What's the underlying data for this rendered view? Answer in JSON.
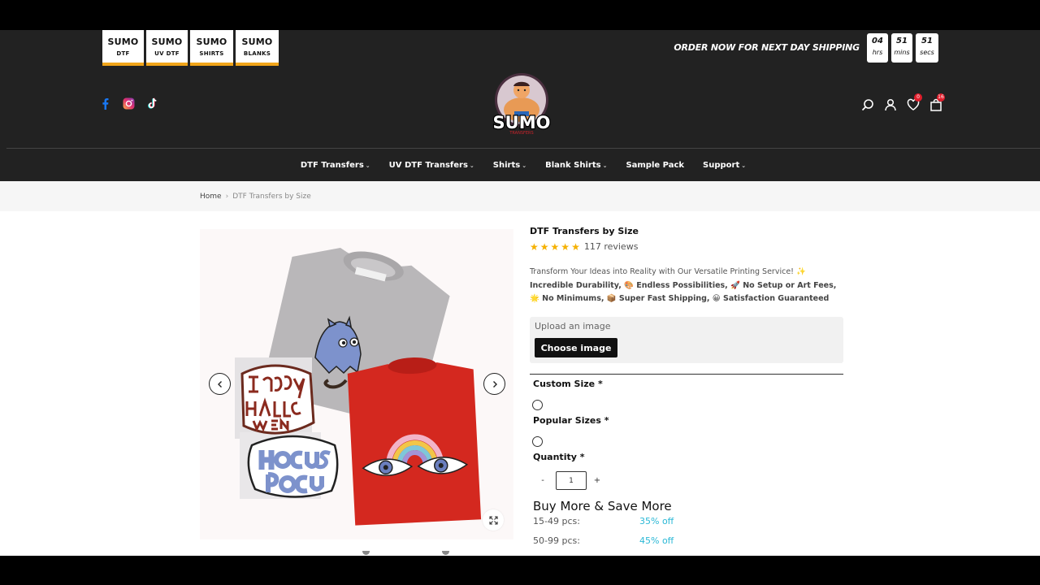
{
  "brand_tabs": [
    {
      "title": "SUMO",
      "sub": "DTF"
    },
    {
      "title": "SUMO",
      "sub": "UV DTF"
    },
    {
      "title": "SUMO",
      "sub": "SHIRTS"
    },
    {
      "title": "SUMO",
      "sub": "BLANKS"
    }
  ],
  "promo": {
    "text": "ORDER NOW FOR NEXT DAY SHIPPING",
    "timer": [
      {
        "value": "04",
        "unit": "hrs"
      },
      {
        "value": "51",
        "unit": "mins"
      },
      {
        "value": "51",
        "unit": "secs"
      }
    ]
  },
  "social": [
    "facebook-icon",
    "instagram-icon",
    "tiktok-icon"
  ],
  "logo": {
    "text": "SUMO",
    "sub": "TRANSFERS"
  },
  "header_icons": {
    "wishlist_count": "0",
    "cart_count": "16"
  },
  "nav": [
    {
      "label": "DTF Transfers",
      "dropdown": true
    },
    {
      "label": "UV DTF Transfers",
      "dropdown": true
    },
    {
      "label": "Shirts",
      "dropdown": true
    },
    {
      "label": "Blank Shirts",
      "dropdown": true
    },
    {
      "label": "Sample Pack",
      "dropdown": false
    },
    {
      "label": "Support",
      "dropdown": true
    }
  ],
  "breadcrumb": {
    "home": "Home",
    "current": "DTF Transfers by Size"
  },
  "product": {
    "title": "DTF Transfers by Size",
    "rating": 5,
    "reviews": "117 reviews",
    "desc_plain": "Transform Your Ideas into Reality with Our Versatile Printing Service! ✨ ",
    "desc_bold_1": "Incredible Durability, 🎨 Endless Possibilities, 🚀 No Setup or Art Fees, 🌟 No Minimums, 📦 Super Fast Shipping, 😀 Satisfaction Guaranteed",
    "upload_placeholder": "Upload an image",
    "choose_label": "Choose image",
    "custom_size_label": "Custom Size *",
    "popular_sizes_label": "Popular Sizes *",
    "quantity_label": "Quantity *",
    "quantity_value": "1",
    "minus": "-",
    "plus": "+",
    "bulk_title": "Buy More & Save More",
    "bulk": [
      {
        "range": "15-49 pcs:",
        "discount": "35% off"
      },
      {
        "range": "50-99 pcs:",
        "discount": "45% off"
      }
    ]
  },
  "colors": {
    "header_bg": "#222222",
    "accent": "#f1a51a",
    "discount": "#2bb8d6",
    "badge": "#e11d2b"
  }
}
